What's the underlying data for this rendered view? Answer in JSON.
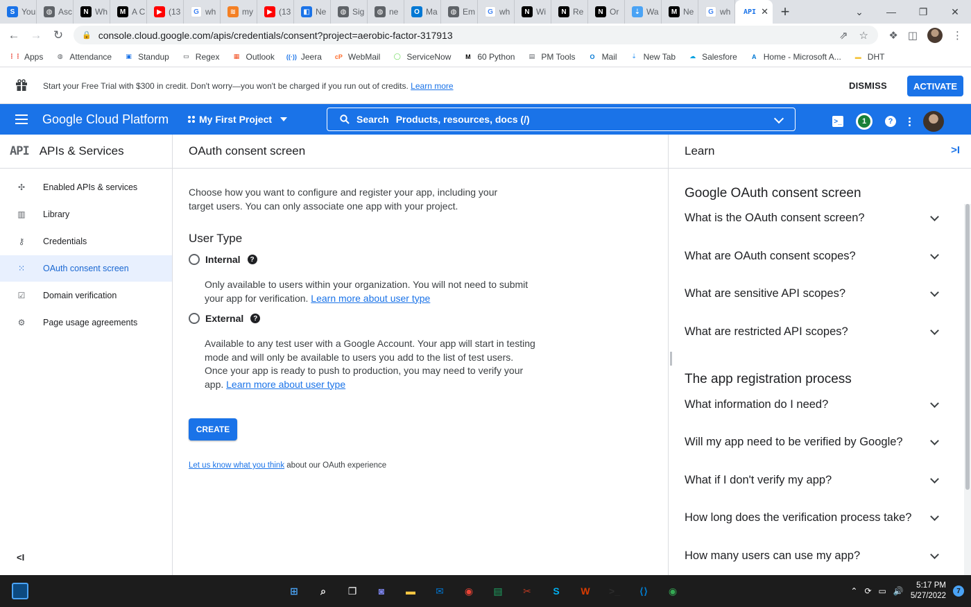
{
  "browser": {
    "tabs": [
      {
        "label": "You",
        "icon": "S",
        "color": "#1a73e8"
      },
      {
        "label": "Asc",
        "icon": "◍",
        "color": "#5f6368"
      },
      {
        "label": "Wh",
        "icon": "N",
        "color": "#000000"
      },
      {
        "label": "A C",
        "icon": "M",
        "color": "#000000"
      },
      {
        "label": "(13",
        "icon": "▶",
        "color": "#ff0000"
      },
      {
        "label": "wh",
        "icon": "G",
        "color": "#ffffff"
      },
      {
        "label": "my",
        "icon": "≋",
        "color": "#f48024"
      },
      {
        "label": "(13",
        "icon": "▶",
        "color": "#ff0000"
      },
      {
        "label": "Ne",
        "icon": "◧",
        "color": "#1a73e8"
      },
      {
        "label": "Sig",
        "icon": "◍",
        "color": "#5f6368"
      },
      {
        "label": "ne",
        "icon": "◍",
        "color": "#5f6368"
      },
      {
        "label": "Ma",
        "icon": "O",
        "color": "#0078d4"
      },
      {
        "label": "Em",
        "icon": "◍",
        "color": "#5f6368"
      },
      {
        "label": "wh",
        "icon": "G",
        "color": "#ffffff"
      },
      {
        "label": "Wi",
        "icon": "N",
        "color": "#000000"
      },
      {
        "label": "Re",
        "icon": "N",
        "color": "#000000"
      },
      {
        "label": "Or",
        "icon": "N",
        "color": "#000000"
      },
      {
        "label": "Wa",
        "icon": "⇣",
        "color": "#4aa3f5"
      },
      {
        "label": "Ne",
        "icon": "M",
        "color": "#000000"
      },
      {
        "label": "wh",
        "icon": "G",
        "color": "#ffffff"
      }
    ],
    "active_tab": {
      "icon": "API",
      "close": "✕"
    },
    "new_tab": "+",
    "window_controls": [
      "⌄",
      "—",
      "❐",
      "✕"
    ],
    "url": "console.cloud.google.com/apis/credentials/consent?project=aerobic-factor-317913",
    "bookmarks": [
      {
        "label": "Apps",
        "icon": "⋮⋮",
        "color": "#ea4335"
      },
      {
        "label": "Attendance",
        "icon": "◍",
        "color": "#5f6368"
      },
      {
        "label": "Standup",
        "icon": "▣",
        "color": "#1a73e8"
      },
      {
        "label": "Regex",
        "icon": "▭",
        "color": "#3c4043"
      },
      {
        "label": "Outlook",
        "icon": "▦",
        "color": "#f25022"
      },
      {
        "label": "Jeera",
        "icon": "((·))",
        "color": "#1a73e8"
      },
      {
        "label": "WebMail",
        "icon": "cP",
        "color": "#ff6c2c"
      },
      {
        "label": "ServiceNow",
        "icon": "◯",
        "color": "#62d84e"
      },
      {
        "label": "60 Python",
        "icon": "M",
        "color": "#000000"
      },
      {
        "label": "PM Tools",
        "icon": "▤",
        "color": "#5f6368"
      },
      {
        "label": "Mail",
        "icon": "O",
        "color": "#0078d4"
      },
      {
        "label": "New Tab",
        "icon": "⇣",
        "color": "#4aa3f5"
      },
      {
        "label": "Salesfore",
        "icon": "☁",
        "color": "#00a1e0"
      },
      {
        "label": "Home - Microsoft A...",
        "icon": "A",
        "color": "#0078d4"
      },
      {
        "label": "DHT",
        "icon": "▬",
        "color": "#f4c542"
      }
    ]
  },
  "trial_banner": {
    "text": "Start your Free Trial with $300 in credit. Don't worry—you won't be charged if you run out of credits.",
    "link": "Learn more",
    "dismiss": "DISMISS",
    "activate": "ACTIVATE"
  },
  "header": {
    "product": "Google Cloud Platform",
    "project": "My First Project",
    "search_label": "Search",
    "search_placeholder": "Products, resources, docs (/)",
    "notification_count": "1",
    "colors": {
      "primary": "#1a73e8"
    }
  },
  "sidebar": {
    "badge": "API",
    "title": "APIs & Services",
    "items": [
      {
        "label": "Enabled APIs & services",
        "icon": "✣",
        "active": false
      },
      {
        "label": "Library",
        "icon": "▥",
        "active": false
      },
      {
        "label": "Credentials",
        "icon": "⚷",
        "active": false
      },
      {
        "label": "OAuth consent screen",
        "icon": "⁙",
        "active": true
      },
      {
        "label": "Domain verification",
        "icon": "☑",
        "active": false
      },
      {
        "label": "Page usage agreements",
        "icon": "⚙",
        "active": false
      }
    ],
    "collapse": "<I"
  },
  "main": {
    "title": "OAuth consent screen",
    "intro": "Choose how you want to configure and register your app, including your target users. You can only associate one app with your project.",
    "user_type_heading": "User Type",
    "internal": {
      "label": "Internal",
      "desc": "Only available to users within your organization. You will not need to submit your app for verification.",
      "link": "Learn more about user type"
    },
    "external": {
      "label": "External",
      "desc": "Available to any test user with a Google Account. Your app will start in testing mode and will only be available to users you add to the list of test users. Once your app is ready to push to production, you may need to verify your app.",
      "link": "Learn more about user type"
    },
    "create_button": "CREATE",
    "feedback_link": "Let us know what you think",
    "feedback_text": " about our OAuth experience"
  },
  "learn": {
    "title": "Learn",
    "collapse": ">I",
    "sections": [
      {
        "heading": "Google OAuth consent screen",
        "questions": [
          "What is the OAuth consent screen?",
          "What are OAuth consent scopes?",
          "What are sensitive API scopes?",
          "What are restricted API scopes?"
        ]
      },
      {
        "heading": "The app registration process",
        "questions": [
          "What information do I need?",
          "Will my app need to be verified by Google?",
          "What if I don't verify my app?",
          "How long does the verification process take?",
          "How many users can use my app?"
        ]
      }
    ]
  },
  "taskbar": {
    "time": "5:17 PM",
    "date": "5/27/2022",
    "notification_count": "7",
    "apps": [
      {
        "name": "windows-start",
        "icon": "⊞",
        "color": "#4aa3f5"
      },
      {
        "name": "search",
        "icon": "⌕",
        "color": "#ffffff"
      },
      {
        "name": "task-view",
        "icon": "❐",
        "color": "#ffffff"
      },
      {
        "name": "chat",
        "icon": "◙",
        "color": "#7b83eb"
      },
      {
        "name": "file-explorer",
        "icon": "▬",
        "color": "#f4c542"
      },
      {
        "name": "mail",
        "icon": "✉",
        "color": "#0078d4"
      },
      {
        "name": "chrome",
        "icon": "◉",
        "color": "#ea4335"
      },
      {
        "name": "sheets",
        "icon": "▤",
        "color": "#1fa463"
      },
      {
        "name": "snip",
        "icon": "✂",
        "color": "#c23b22"
      },
      {
        "name": "skype",
        "icon": "S",
        "color": "#00aff0"
      },
      {
        "name": "wps",
        "icon": "W",
        "color": "#d83b01"
      },
      {
        "name": "terminal",
        "icon": ">_",
        "color": "#2d2d2d"
      },
      {
        "name": "vscode",
        "icon": "⟨⟩",
        "color": "#007acc"
      },
      {
        "name": "chrome-profile",
        "icon": "◉",
        "color": "#34a853"
      }
    ]
  }
}
